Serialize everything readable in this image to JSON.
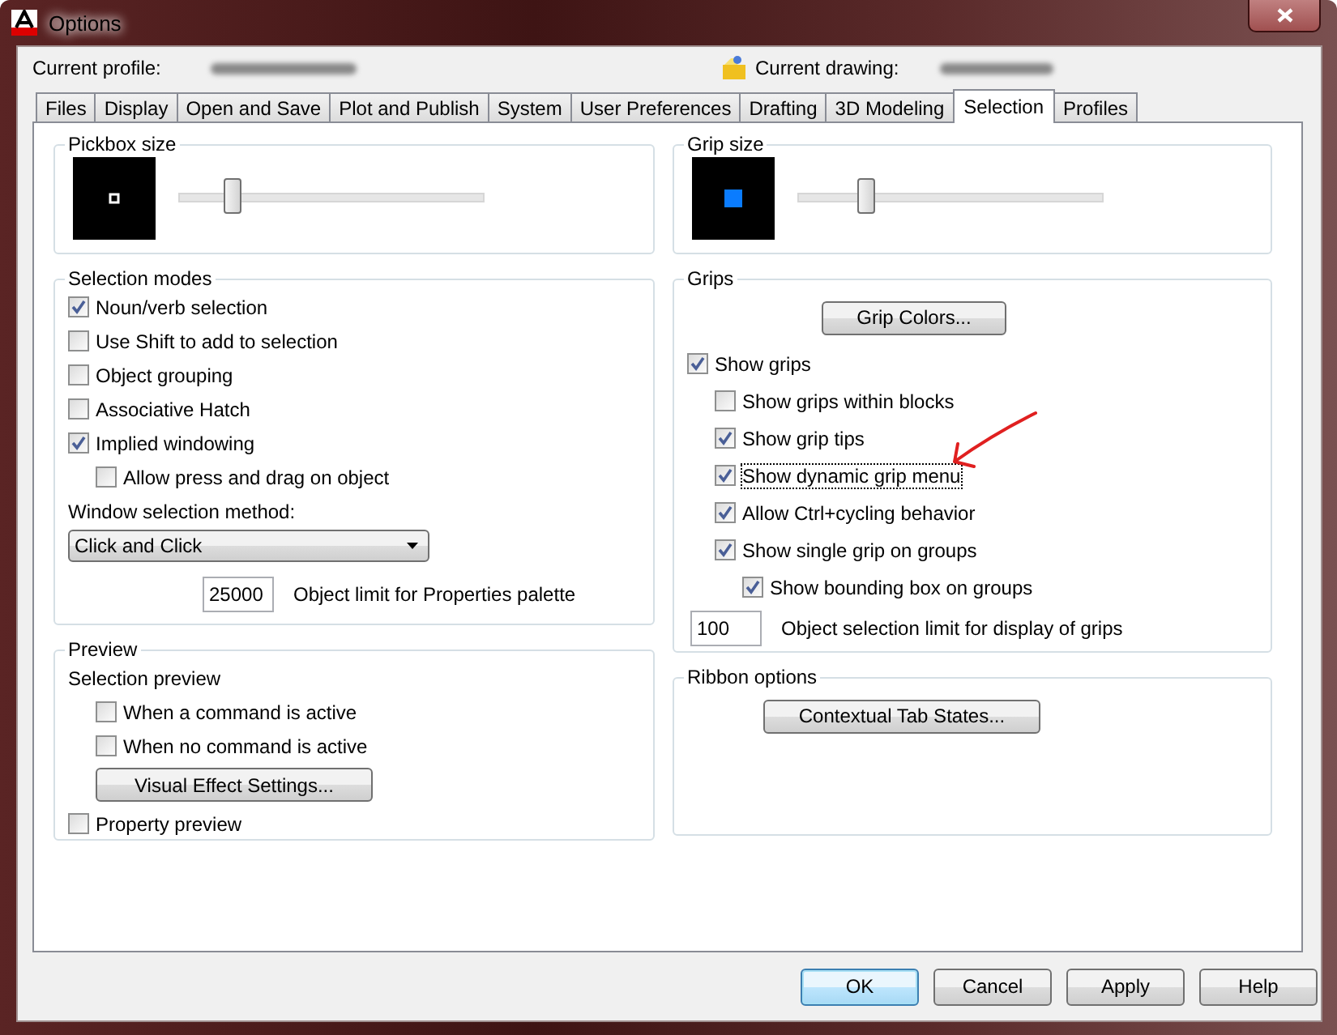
{
  "window": {
    "title": "Options"
  },
  "header": {
    "profile_label": "Current profile:",
    "drawing_label": "Current drawing:"
  },
  "tabs": [
    {
      "label": "Files",
      "selected": false
    },
    {
      "label": "Display",
      "selected": false
    },
    {
      "label": "Open and Save",
      "selected": false
    },
    {
      "label": "Plot and Publish",
      "selected": false
    },
    {
      "label": "System",
      "selected": false
    },
    {
      "label": "User Preferences",
      "selected": false
    },
    {
      "label": "Drafting",
      "selected": false
    },
    {
      "label": "3D Modeling",
      "selected": false
    },
    {
      "label": "Selection",
      "selected": true
    },
    {
      "label": "Profiles",
      "selected": false
    }
  ],
  "columns": [
    [
      {
        "title": "Pickbox size",
        "items": [
          {
            "kind": "pickbox",
            "level": 0.17
          }
        ]
      },
      {
        "title": "Selection modes",
        "items": [
          {
            "kind": "checkbox",
            "label": "Noun/verb selection",
            "checked": true
          },
          {
            "kind": "checkbox",
            "label": "Use Shift to add to selection",
            "checked": false
          },
          {
            "kind": "checkbox",
            "label": "Object grouping",
            "checked": false
          },
          {
            "kind": "checkbox",
            "label": "Associative Hatch",
            "checked": false
          },
          {
            "kind": "checkbox",
            "label": "Implied windowing",
            "checked": true,
            "children": [
              {
                "kind": "checkbox",
                "label": "Allow press and drag on object",
                "checked": false
              }
            ]
          },
          {
            "kind": "label",
            "label": "Window selection method:"
          },
          {
            "kind": "dropdown",
            "value": "Click and Click"
          },
          {
            "kind": "number",
            "value": "25000",
            "label": "Object limit for Properties palette"
          }
        ]
      },
      {
        "title": "Preview",
        "items": [
          {
            "kind": "label",
            "label": "Selection preview",
            "children": [
              {
                "kind": "checkbox",
                "label": "When a command is active",
                "checked": false
              },
              {
                "kind": "checkbox",
                "label": "When no command is active",
                "checked": false
              },
              {
                "kind": "button",
                "label": "Visual Effect Settings..."
              }
            ]
          },
          {
            "kind": "checkbox",
            "label": "Property preview",
            "checked": false
          }
        ]
      }
    ],
    [
      {
        "title": "Grip size",
        "items": [
          {
            "kind": "grip",
            "level": 0.22
          }
        ]
      },
      {
        "title": "Grips",
        "items": [
          {
            "kind": "button",
            "label": "Grip Colors..."
          },
          {
            "kind": "checkbox",
            "label": "Show grips",
            "checked": true,
            "children": [
              {
                "kind": "checkbox",
                "label": "Show grips within blocks",
                "checked": false
              },
              {
                "kind": "checkbox",
                "label": "Show grip tips",
                "checked": true
              },
              {
                "kind": "checkbox",
                "label": "Show dynamic grip menu",
                "checked": true,
                "focused": true
              },
              {
                "kind": "checkbox",
                "label": "Allow Ctrl+cycling behavior",
                "checked": true
              },
              {
                "kind": "checkbox",
                "label": "Show single grip on groups",
                "checked": true,
                "children": [
                  {
                    "kind": "checkbox",
                    "label": "Show bounding box on groups",
                    "checked": true
                  }
                ]
              }
            ]
          },
          {
            "kind": "number",
            "value": "100",
            "label": "Object selection limit for display of grips"
          }
        ]
      },
      {
        "title": "Ribbon options",
        "items": [
          {
            "kind": "button",
            "label": "Contextual Tab States..."
          }
        ]
      }
    ]
  ],
  "buttons": [
    {
      "label": "OK",
      "default": true
    },
    {
      "label": "Cancel",
      "default": false
    },
    {
      "label": "Apply",
      "default": false
    },
    {
      "label": "Help",
      "default": false
    }
  ]
}
